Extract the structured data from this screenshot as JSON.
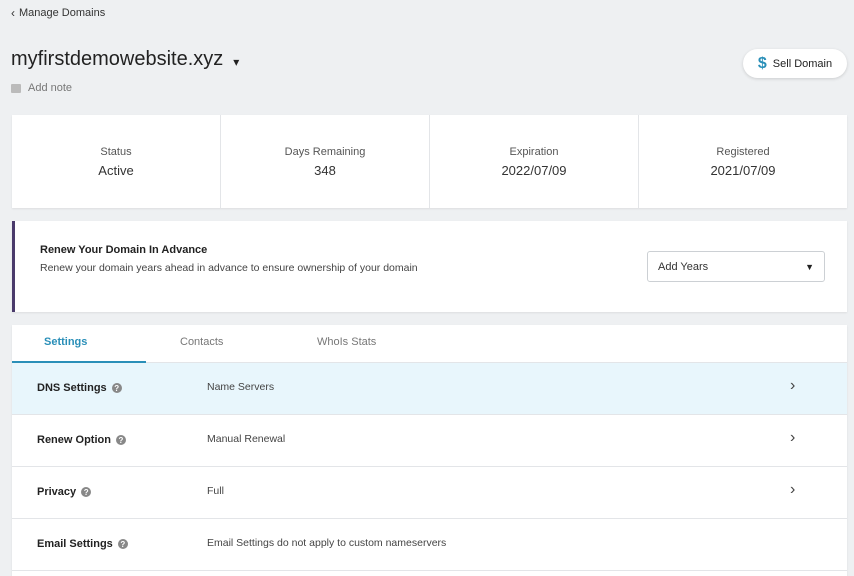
{
  "header": {
    "back_label": "Manage Domains",
    "domain": "myfirstdemowebsite.xyz",
    "add_note": "Add note",
    "sell_label": "Sell Domain"
  },
  "stats": [
    {
      "label": "Status",
      "value": "Active"
    },
    {
      "label": "Days Remaining",
      "value": "348"
    },
    {
      "label": "Expiration",
      "value": "2022/07/09"
    },
    {
      "label": "Registered",
      "value": "2021/07/09"
    }
  ],
  "renew": {
    "title": "Renew Your Domain In Advance",
    "description": "Renew your domain years ahead in advance to ensure ownership of your domain",
    "select_value": "Add Years"
  },
  "tabs": [
    {
      "label": "Settings",
      "active": true
    },
    {
      "label": "Contacts",
      "active": false
    },
    {
      "label": "WhoIs Stats",
      "active": false
    }
  ],
  "rows": [
    {
      "label": "DNS Settings",
      "value": "Name Servers",
      "chevron": true
    },
    {
      "label": "Renew Option",
      "value": "Manual Renewal",
      "chevron": true
    },
    {
      "label": "Privacy",
      "value": "Full",
      "chevron": true
    },
    {
      "label": "Email Settings",
      "value": "Email Settings do not apply to custom nameservers",
      "chevron": false
    }
  ],
  "colors": {
    "accent": "#2a8fb8",
    "renew_border": "#4a3a6b",
    "highlight_row": "#e8f6fc"
  }
}
